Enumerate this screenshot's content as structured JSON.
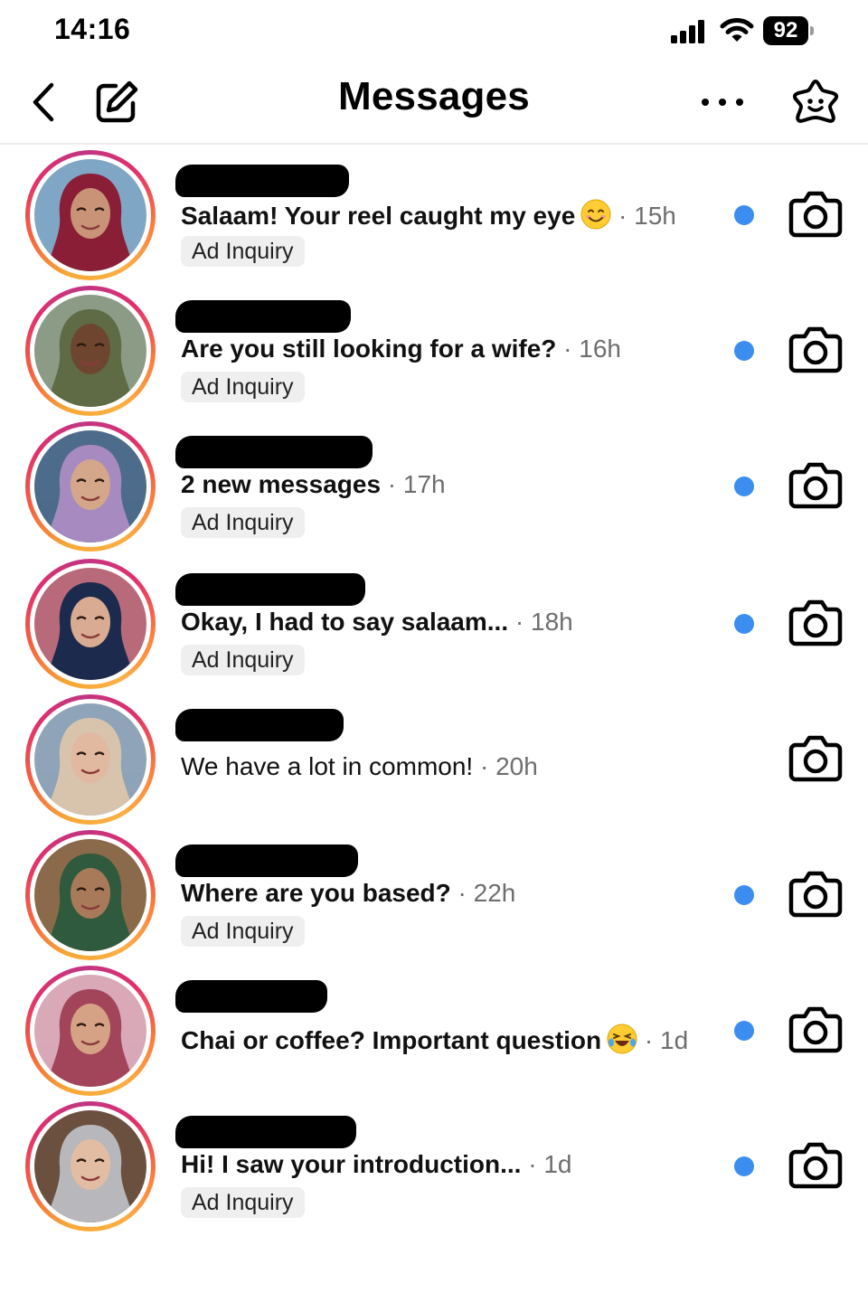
{
  "status_bar": {
    "time": "14:16",
    "battery": "92"
  },
  "header": {
    "title": "Messages"
  },
  "icons": {
    "back": "chevron-left-icon",
    "compose": "compose-icon",
    "more": "more-icon",
    "ai": "ai-sparkle-icon",
    "camera": "camera-icon"
  },
  "colors": {
    "unread_dot": "#3b8ef0",
    "meta_text": "#6e6e6e",
    "chip_bg": "#efefef"
  },
  "threads": [
    {
      "message": "Salaam! Your reel caught my eye",
      "emoji": "smiling-face",
      "meta": " · 15h",
      "label": "Ad Inquiry",
      "unread": true,
      "avatar": {
        "bg": "#7fa6c4",
        "scarf": "#8a1e36",
        "skin": "#c99378"
      }
    },
    {
      "message": "Are you still looking for a wife?",
      "emoji": "",
      "meta": " · 16h",
      "label": "Ad Inquiry",
      "unread": true,
      "avatar": {
        "bg": "#8c9b86",
        "scarf": "#5e6b45",
        "skin": "#6e4630"
      }
    },
    {
      "message": "2 new messages",
      "emoji": "",
      "meta": " · 17h",
      "label": "Ad Inquiry",
      "unread": true,
      "avatar": {
        "bg": "#4d6b8a",
        "scarf": "#a68ac0",
        "skin": "#d4a68a"
      }
    },
    {
      "message": "Okay, I had to say salaam...",
      "emoji": "",
      "meta": " · 18h",
      "label": "Ad Inquiry",
      "unread": true,
      "avatar": {
        "bg": "#b86a7a",
        "scarf": "#1c2b4d",
        "skin": "#d8ab92"
      }
    },
    {
      "message": "We have a lot in common!",
      "emoji": "",
      "meta": " · 20h",
      "label": "",
      "unread": false,
      "avatar": {
        "bg": "#8fa4b8",
        "scarf": "#d8c4ad",
        "skin": "#e0b9a0"
      }
    },
    {
      "message": "Where are you based?",
      "emoji": "",
      "meta": " · 22h",
      "label": "Ad Inquiry",
      "unread": true,
      "avatar": {
        "bg": "#8a6a4a",
        "scarf": "#2f5a3e",
        "skin": "#a87a5a"
      }
    },
    {
      "message": "Chai or coffee? Important question",
      "emoji": "laughing-face",
      "meta": " · 1d",
      "label": "",
      "unread": true,
      "avatar": {
        "bg": "#d9a9b8",
        "scarf": "#a3455a",
        "skin": "#d6a286"
      }
    },
    {
      "message": "Hi! I saw your introduction...",
      "emoji": "",
      "meta": " · 1d",
      "label": "Ad Inquiry",
      "unread": true,
      "avatar": {
        "bg": "#6b5040",
        "scarf": "#b8b8bc",
        "skin": "#e2bca3"
      }
    }
  ]
}
